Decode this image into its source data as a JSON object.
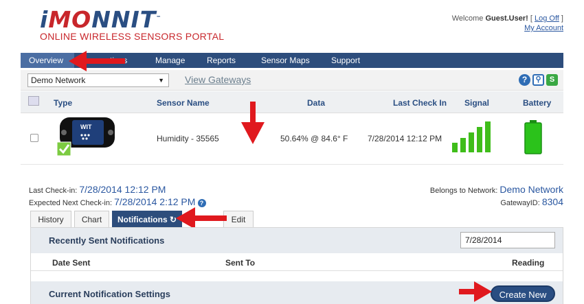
{
  "header": {
    "logo_main_left": "i",
    "logo_main_o": "MO",
    "logo_main_right": "NNIT",
    "logo_tm": "™",
    "logo_sub": "ONLINE WIRELESS SENSORS PORTAL",
    "welcome_prefix": "Welcome ",
    "welcome_user": "Guest.User!",
    "log_off_open": " [ ",
    "log_off": "Log Off",
    "log_off_close": " ]",
    "my_account": "My Account"
  },
  "nav": {
    "items": [
      {
        "label": "Overview"
      },
      {
        "label": "Notifications"
      },
      {
        "label": "Manage"
      },
      {
        "label": "Reports"
      },
      {
        "label": "Sensor Maps"
      },
      {
        "label": "Support"
      }
    ],
    "visible_tail": "tions"
  },
  "toolbar": {
    "network_selected": "Demo Network",
    "view_gateways": "View Gateways"
  },
  "table": {
    "headers": {
      "type": "Type",
      "sensor_name": "Sensor Name",
      "data": "Data",
      "last_check_in": "Last Check In",
      "signal": "Signal",
      "battery": "Battery"
    },
    "rows": [
      {
        "sensor_name": "Humidity - 35565",
        "data": "50.64% @ 84.6° F",
        "last_check_in": "7/28/2014 12:12 PM",
        "device_brand": "MONNIT",
        "device_model": "WIT",
        "device_type": "HUMIDITY"
      }
    ]
  },
  "info": {
    "last_checkin_label": "Last Check-in: ",
    "last_checkin_value": "7/28/2014 12:12 PM",
    "next_checkin_label": "Expected Next Check-in: ",
    "next_checkin_value": "7/28/2014 2:12 PM",
    "belongs_label": "Belongs to Network: ",
    "belongs_value": "Demo Network",
    "gateway_label": "GatewayID: ",
    "gateway_value": "8304"
  },
  "tabs": [
    {
      "label": "History"
    },
    {
      "label": "Chart"
    },
    {
      "label": "Notifications"
    },
    {
      "label": "Edit"
    }
  ],
  "notifications": {
    "recent_title": "Recently Sent Notifications",
    "date_value": "7/28/2014",
    "col_date_sent": "Date Sent",
    "col_sent_to": "Sent To",
    "col_reading": "Reading",
    "settings_title": "Current Notification Settings",
    "create_new": "Create New"
  },
  "colors": {
    "nav_bg": "#2d4d7c",
    "accent_red": "#e0191e",
    "signal_green": "#3fbd1a",
    "battery_green": "#2bc21b"
  }
}
